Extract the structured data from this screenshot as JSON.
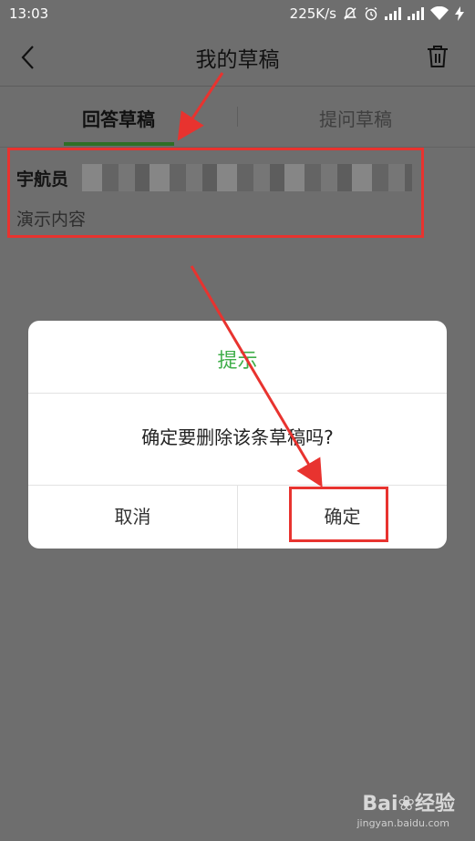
{
  "status_bar": {
    "time": "13:03",
    "net_speed": "225K/s",
    "icons": [
      "mute-icon",
      "alarm-icon",
      "signal-icon",
      "signal-icon",
      "wifi-icon",
      "charging-icon"
    ]
  },
  "header": {
    "title": "我的草稿",
    "back_icon": "chevron-left-icon",
    "trash_icon": "trash-icon"
  },
  "tabs": [
    {
      "label": "回答草稿",
      "selected": true
    },
    {
      "label": "提问草稿",
      "selected": false
    }
  ],
  "draft": {
    "title": "宇航员",
    "content": "演示内容"
  },
  "dialog": {
    "title": "提示",
    "message": "确定要删除该条草稿吗?",
    "cancel_label": "取消",
    "confirm_label": "确定"
  },
  "watermark": {
    "brand_a": "Bai",
    "brand_b": "经验",
    "url": "jingyan.baidu.com"
  },
  "colors": {
    "overlay": "#6e6e6e",
    "accent_green": "#3fae49",
    "tab_indicator": "#2f6e26",
    "annotation_red": "#e8332f"
  }
}
